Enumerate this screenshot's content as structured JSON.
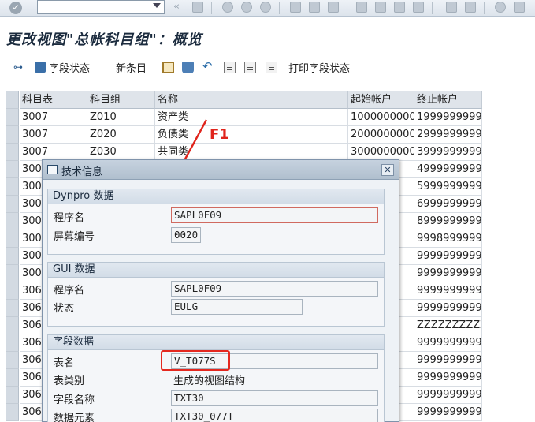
{
  "system_toolbar": {
    "ok_icon": "checkmark-icon",
    "command_value": "",
    "dropdown_icon": "chevron-down-icon"
  },
  "screen_title": "更改视图\"总帐科目组\"：概览",
  "app_toolbar": {
    "field_status": "字段状态",
    "new_entries": "新条目",
    "print_field_status": "打印字段状态"
  },
  "table": {
    "columns": [
      "科目表",
      "科目组",
      "名称",
      "起始帐户",
      "终止帐户"
    ],
    "rows": [
      [
        "3007",
        "Z010",
        "资产类",
        "1000000000",
        "1999999999"
      ],
      [
        "3007",
        "Z020",
        "负债类",
        "2000000000",
        "2999999999"
      ],
      [
        "3007",
        "Z030",
        "共同类",
        "3000000000",
        "3999999999"
      ],
      [
        "300",
        "",
        "",
        "",
        "4999999999"
      ],
      [
        "300",
        "",
        "",
        "",
        "5999999999"
      ],
      [
        "300",
        "",
        "",
        "",
        "6999999999"
      ],
      [
        "300",
        "",
        "",
        "",
        "8999999999"
      ],
      [
        "300",
        "",
        "",
        "",
        "9998999999"
      ],
      [
        "300",
        "",
        "",
        "",
        "9999999999"
      ],
      [
        "300",
        "",
        "",
        "",
        "9999999999"
      ],
      [
        "306",
        "",
        "",
        "",
        "9999999999"
      ],
      [
        "306",
        "",
        "",
        "",
        "9999999999"
      ],
      [
        "306",
        "",
        "",
        "",
        "ZZZZZZZZZZ"
      ],
      [
        "306",
        "",
        "",
        "",
        "9999999999"
      ],
      [
        "306",
        "",
        "",
        "",
        "9999999999"
      ],
      [
        "306",
        "",
        "",
        "",
        "9999999999"
      ],
      [
        "306",
        "",
        "",
        "",
        "9999999999"
      ],
      [
        "306",
        "",
        "",
        "",
        "9999999999"
      ]
    ]
  },
  "annotation": {
    "label": "F1",
    "color": "#e0241c"
  },
  "dialog": {
    "title": "技术信息",
    "dynpro": {
      "header": "Dynpro 数据",
      "program_label": "程序名",
      "program_value": "SAPL0F09",
      "screen_label": "屏幕编号",
      "screen_value": "0020"
    },
    "gui": {
      "header": "GUI 数据",
      "program_label": "程序名",
      "program_value": "SAPL0F09",
      "status_label": "状态",
      "status_value": "EULG"
    },
    "field": {
      "header": "字段数据",
      "table_label": "表名",
      "table_value": "V_T077S",
      "table_type_label": "表类别",
      "table_type_value": "生成的视图结构",
      "field_name_label": "字段名称",
      "field_name_value": "TXT30",
      "data_element_label": "数据元素",
      "data_element_value": "TXT30_077T"
    }
  }
}
